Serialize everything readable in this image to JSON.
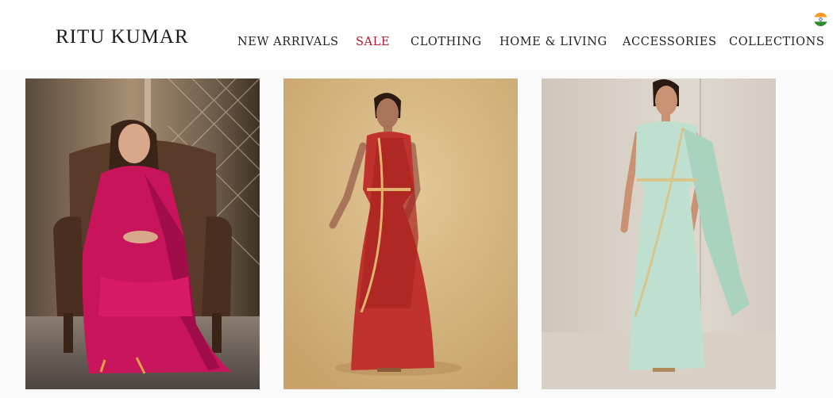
{
  "header": {
    "brand": "RITU KUMAR",
    "flag_icon": "india-flag-icon",
    "nav": [
      {
        "label": "NEW ARRIVALS",
        "color": "#222222"
      },
      {
        "label": "SALE",
        "color": "#b0192c"
      },
      {
        "label": "CLOTHING",
        "color": "#222222"
      },
      {
        "label": "HOME & LIVING",
        "color": "#222222"
      },
      {
        "label": "ACCESSORIES",
        "color": "#222222"
      },
      {
        "label": "COLLECTIONS",
        "color": "#222222"
      }
    ]
  },
  "products": [
    {
      "image": "model in magenta embroidered saree seated in leather armchair",
      "color": "#c8145a"
    },
    {
      "image": "model in red pre-draped saree gown on beige backdrop",
      "color": "#c0322e"
    },
    {
      "image": "model in mint green pre-draped saree on grey backdrop",
      "color": "#bfe0d0"
    }
  ]
}
